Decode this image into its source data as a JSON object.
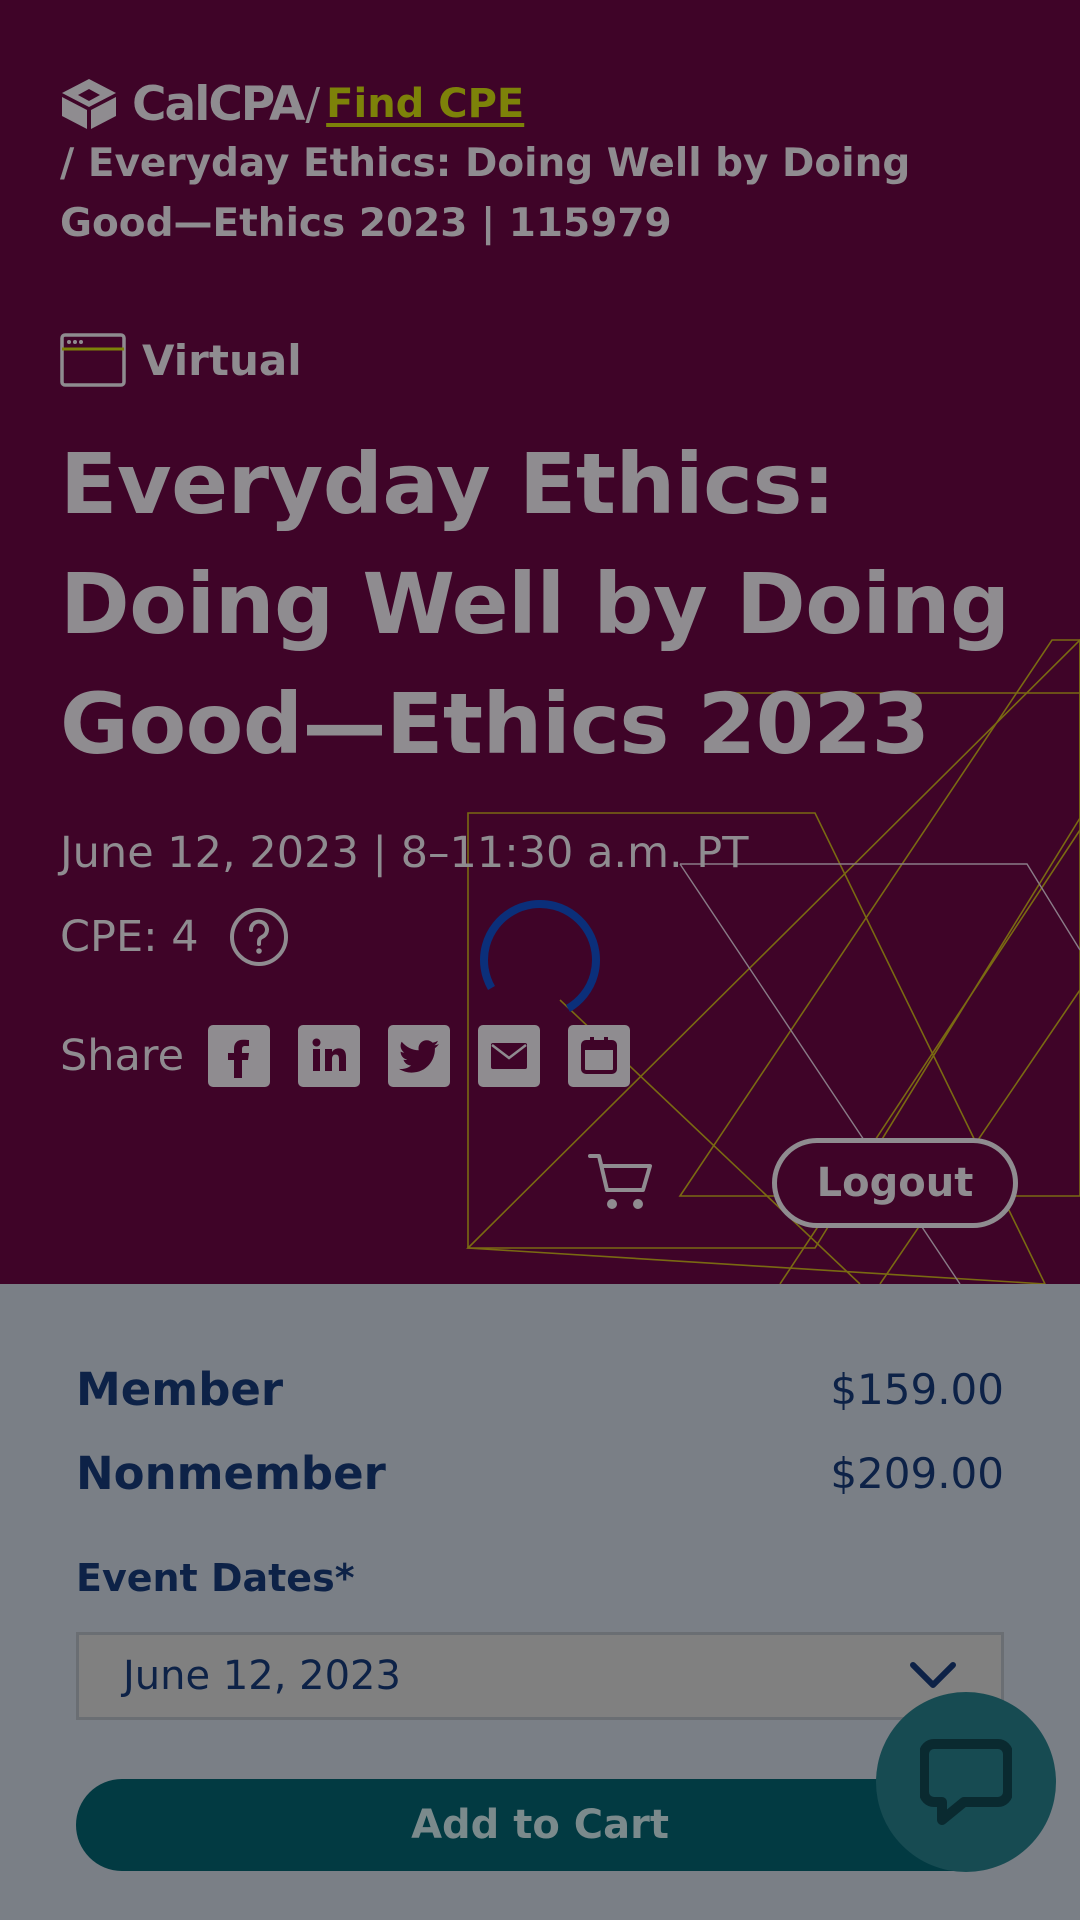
{
  "breadcrumb": {
    "logo_text": "CalCPA",
    "separator": "/",
    "link_label": "Find CPE",
    "current": "/ Everyday Ethics: Doing Well by Doing Good—Ethics 2023 | 115979"
  },
  "event": {
    "format_label": "Virtual",
    "title": "Everyday Ethics: Doing Well by Doing Good—Ethics 2023",
    "datetime": "June 12, 2023 | 8–11:30 a.m. PT",
    "cpe_label": "CPE: 4"
  },
  "share": {
    "label": "Share",
    "icons": [
      "facebook-icon",
      "linkedin-icon",
      "twitter-icon",
      "email-icon",
      "calendar-icon"
    ]
  },
  "header_actions": {
    "logout_label": "Logout"
  },
  "pricing": [
    {
      "label": "Member",
      "price": "$159.00"
    },
    {
      "label": "Nonmember",
      "price": "$209.00"
    }
  ],
  "event_dates": {
    "label": "Event Dates*",
    "selected": "June 12, 2023"
  },
  "cart": {
    "add_label": "Add to Cart"
  },
  "colors": {
    "hero_bg": "#3f0428",
    "accent_link": "#7d8209",
    "navy_text": "#0d2247",
    "button_teal": "#023a42",
    "overlay_gray": "#7a7f86"
  }
}
